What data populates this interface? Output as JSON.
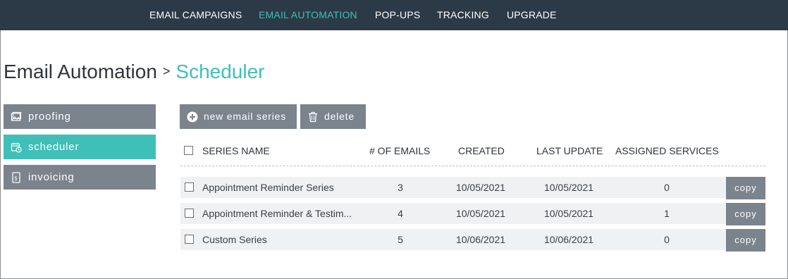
{
  "nav": {
    "items": [
      {
        "label": "EMAIL CAMPAIGNS"
      },
      {
        "label": "EMAIL AUTOMATION"
      },
      {
        "label": "POP-UPS"
      },
      {
        "label": "TRACKING"
      },
      {
        "label": "UPGRADE"
      }
    ],
    "active": "EMAIL AUTOMATION"
  },
  "breadcrumb": {
    "parent": "Email Automation",
    "separator": ">",
    "current": "Scheduler"
  },
  "sidebar": {
    "items": [
      {
        "label": "proofing",
        "icon": "image-icon"
      },
      {
        "label": "scheduler",
        "icon": "calendar-clock-icon"
      },
      {
        "label": "invoicing",
        "icon": "invoice-icon"
      }
    ],
    "active": "scheduler"
  },
  "toolbar": {
    "new_label": "new email series",
    "delete_label": "delete"
  },
  "table": {
    "headers": {
      "name": "SERIES NAME",
      "emails": "# OF EMAILS",
      "created": "CREATED",
      "updated": "LAST UPDATE",
      "services": "ASSIGNED SERVICES"
    },
    "rows": [
      {
        "name": "Appointment Reminder Series",
        "emails": "3",
        "created": "10/05/2021",
        "updated": "10/05/2021",
        "services": "0",
        "action": "copy"
      },
      {
        "name": "Appointment Reminder & Testim...",
        "emails": "4",
        "created": "10/05/2021",
        "updated": "10/05/2021",
        "services": "1",
        "action": "copy"
      },
      {
        "name": "Custom Series",
        "emails": "5",
        "created": "10/06/2021",
        "updated": "10/06/2021",
        "services": "0",
        "action": "copy"
      }
    ]
  },
  "colors": {
    "nav_bg": "#2c3a47",
    "accent": "#3fbfb8",
    "button_gray": "#7b838c",
    "row_bg": "#f0f1f2"
  }
}
